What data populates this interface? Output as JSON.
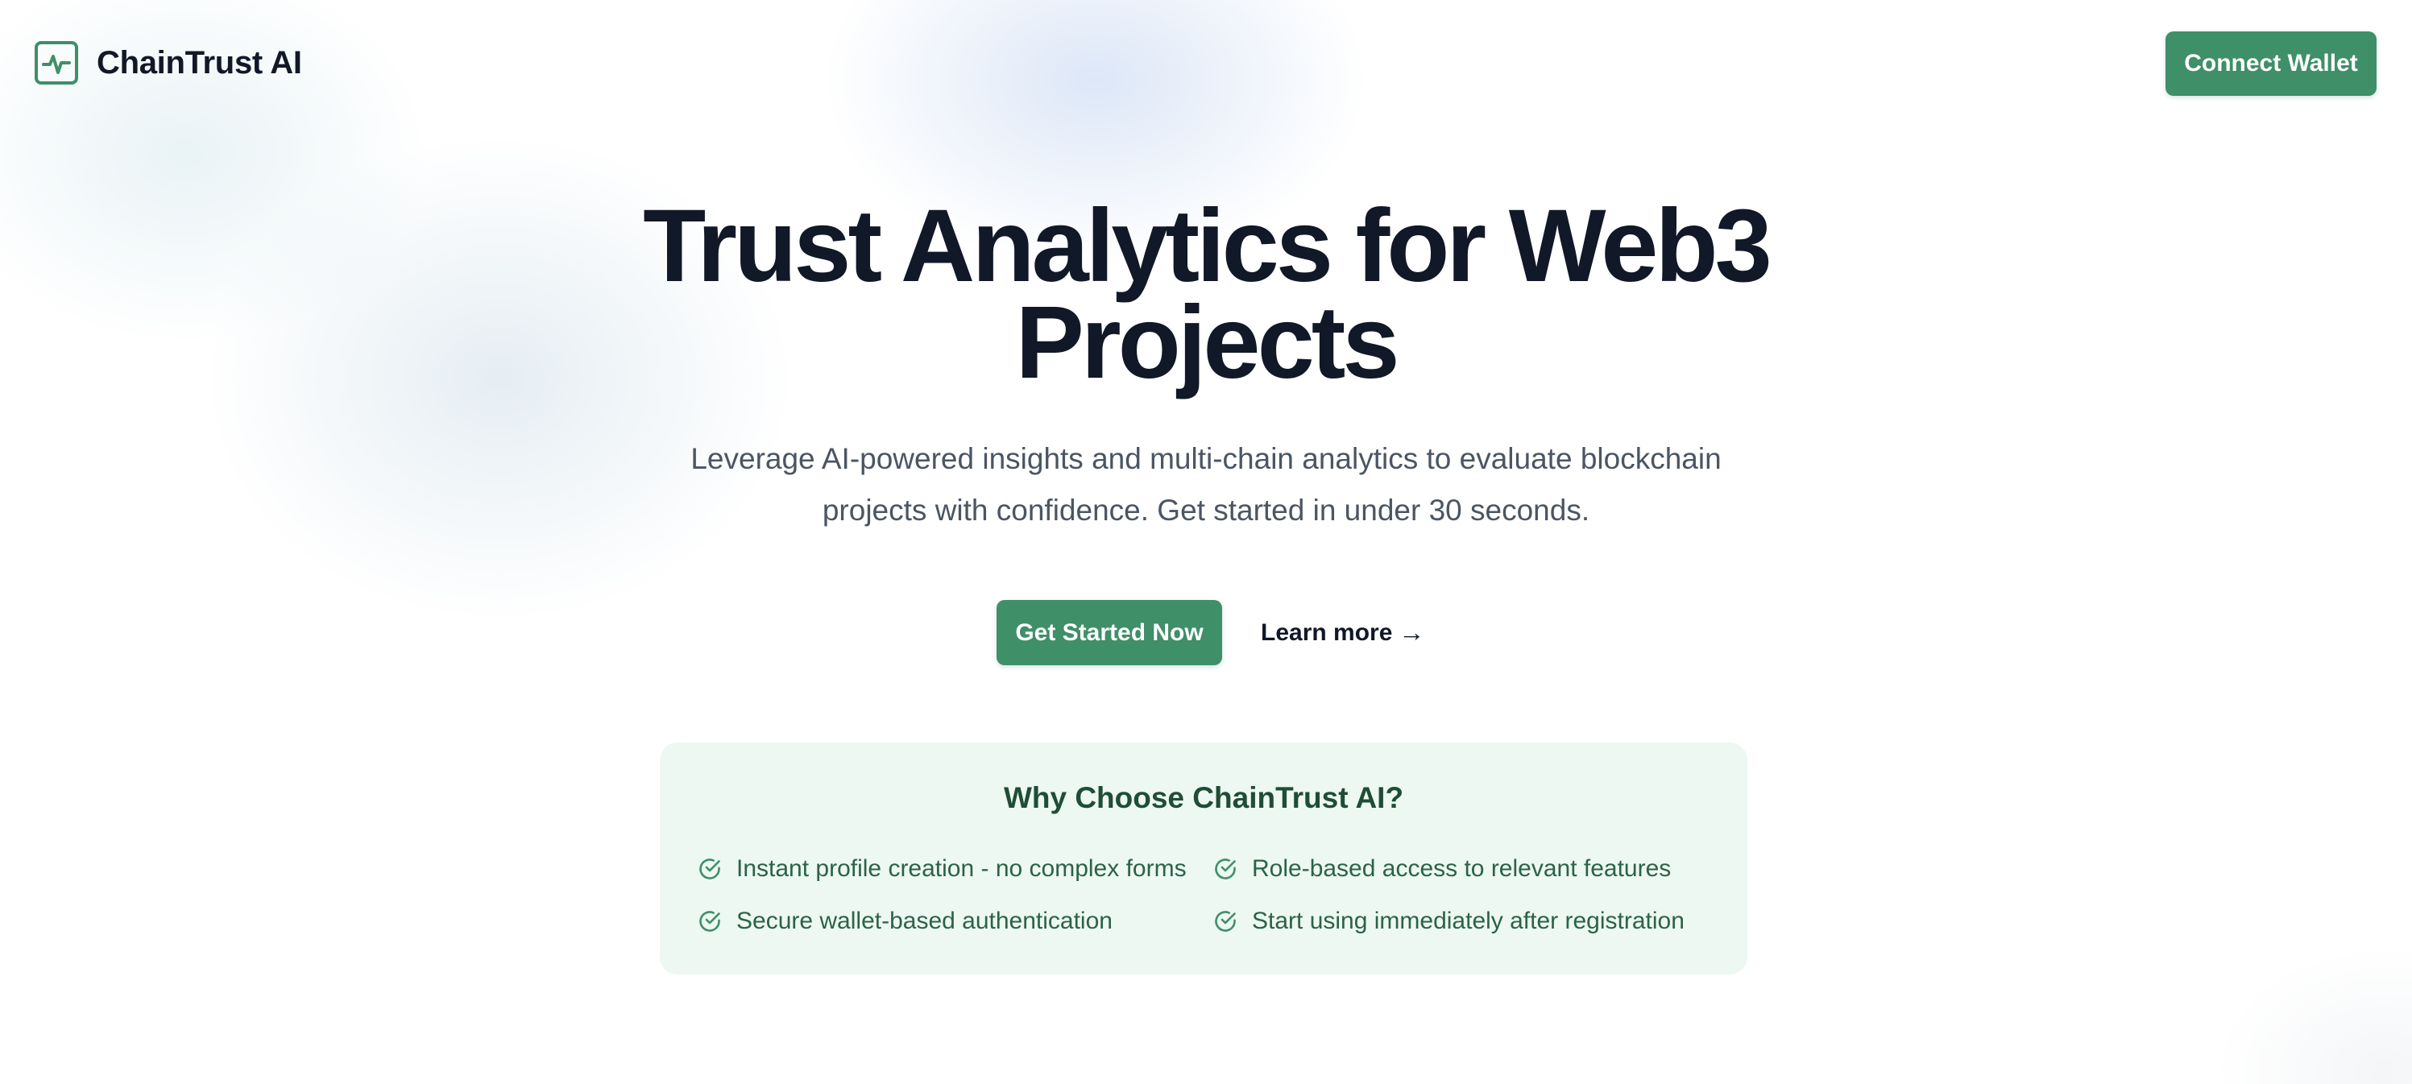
{
  "brand": {
    "name": "ChainTrust AI",
    "logo_icon": "activity-pulse-icon",
    "accent_color": "#3f8f68"
  },
  "header": {
    "connect_label": "Connect Wallet"
  },
  "hero": {
    "title_line1": "Trust Analytics for Web3",
    "title_line2": "Projects",
    "subtitle_line1": "Leverage AI-powered insights and multi-chain analytics to evaluate blockchain",
    "subtitle_line2": "projects with confidence. Get started in under 30 seconds.",
    "primary_cta": "Get Started Now",
    "secondary_cta": "Learn more",
    "secondary_cta_arrow": "→"
  },
  "features": {
    "title": "Why Choose ChainTrust AI?",
    "item_icon": "check-circle-icon",
    "items": [
      "Instant profile creation - no complex forms",
      "Role-based access to relevant features",
      "Secure wallet-based authentication",
      "Start using immediately after registration"
    ]
  }
}
